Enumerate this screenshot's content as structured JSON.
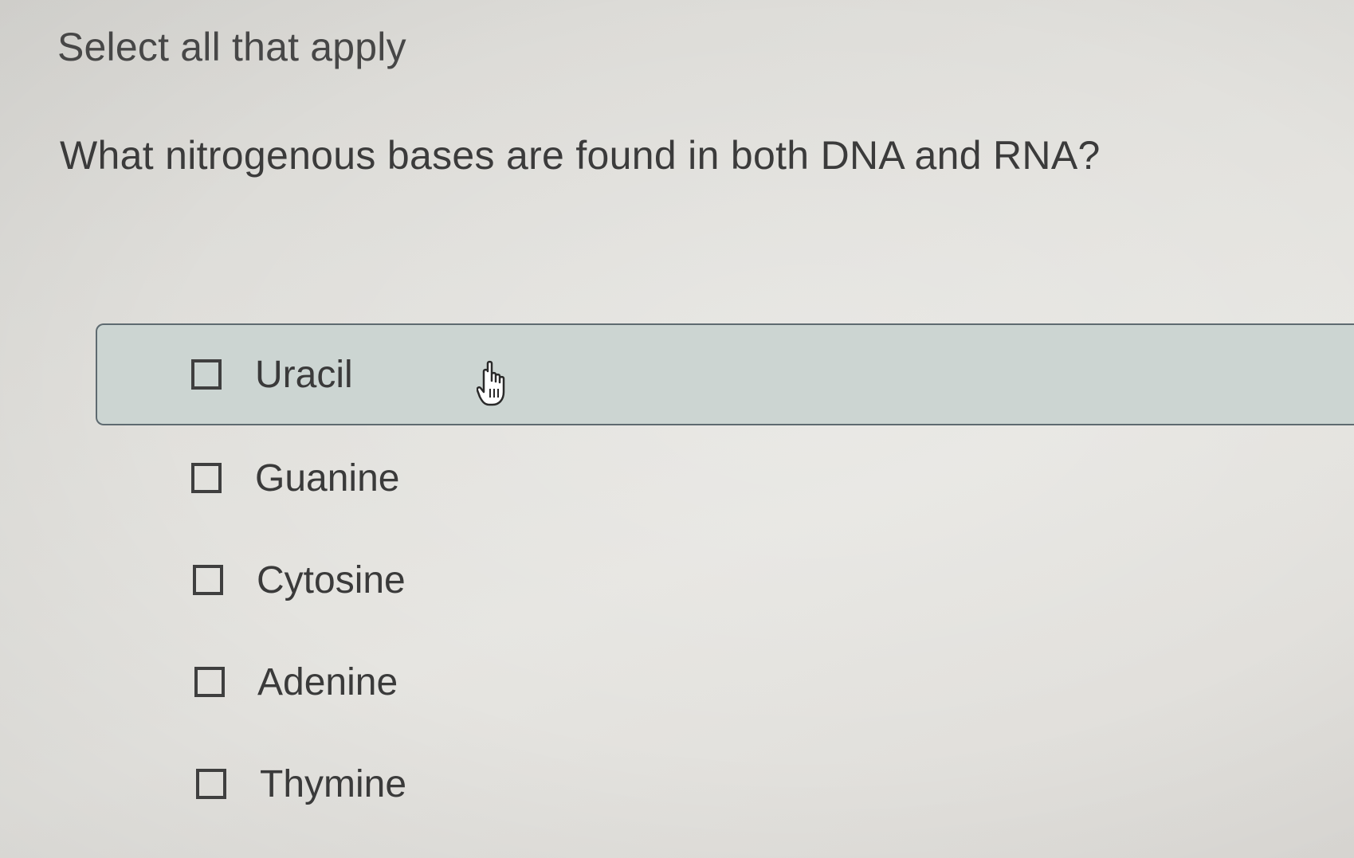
{
  "instruction": "Select all that apply",
  "question": "What nitrogenous bases are found in both DNA and RNA?",
  "options": [
    {
      "label": "Uracil",
      "checked": false,
      "hovered": true
    },
    {
      "label": "Guanine",
      "checked": false,
      "hovered": false
    },
    {
      "label": "Cytosine",
      "checked": false,
      "hovered": false
    },
    {
      "label": "Adenine",
      "checked": false,
      "hovered": false
    },
    {
      "label": "Thymine",
      "checked": false,
      "hovered": false
    }
  ],
  "cursor": {
    "icon": "pointer-hand-icon"
  },
  "colors": {
    "background": "#e1e0dc",
    "hover_fill": "#ccd5d2",
    "hover_border": "#5e6a70",
    "text": "#3a3a3a"
  }
}
